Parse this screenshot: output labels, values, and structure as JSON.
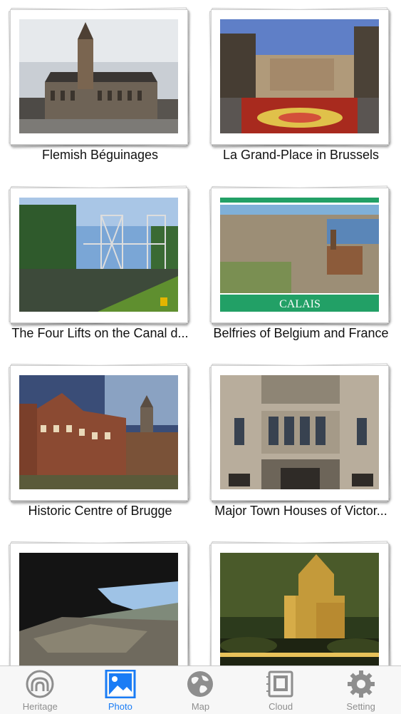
{
  "items": [
    {
      "title": "Flemish Béguinages"
    },
    {
      "title": "La Grand-Place in Brussels"
    },
    {
      "title": "The Four Lifts on the Canal d..."
    },
    {
      "title": "Belfries of Belgium and France"
    },
    {
      "title": "Historic Centre of Brugge"
    },
    {
      "title": "Major Town Houses of Victor..."
    },
    {
      "title": ""
    },
    {
      "title": ""
    }
  ],
  "photo_text": {
    "calais": "CALAIS"
  },
  "tabs": [
    {
      "label": "Heritage",
      "icon": "heritage-icon",
      "active": false
    },
    {
      "label": "Photo",
      "icon": "photo-icon",
      "active": true
    },
    {
      "label": "Map",
      "icon": "globe-icon",
      "active": false
    },
    {
      "label": "Cloud",
      "icon": "cloud-icon",
      "active": false
    },
    {
      "label": "Setting",
      "icon": "gear-icon",
      "active": false
    }
  ],
  "colors": {
    "accent": "#1a7cf5",
    "inactive": "#8e8e8e",
    "tabbar_bg": "#f7f7f7"
  }
}
